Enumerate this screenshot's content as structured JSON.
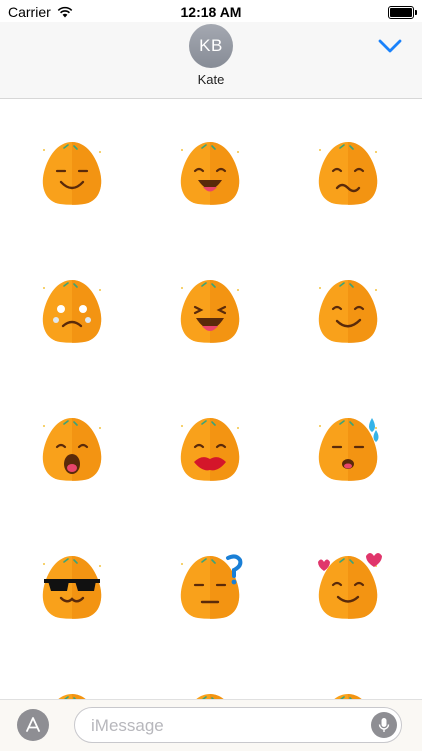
{
  "status_bar": {
    "carrier": "Carrier",
    "time": "12:18 AM",
    "icons": [
      "wifi-icon",
      "battery-icon"
    ]
  },
  "header": {
    "avatar_initials": "KB",
    "contact_name": "Kate",
    "collapse_icon": "chevron-down-icon",
    "accent_color": "#1a82fb"
  },
  "stickers": {
    "colors": {
      "body": "#f9a11b",
      "shade": "#ef8a0b",
      "mouth": "#5a2a0a",
      "tongue": "#e8456b",
      "accent_lips": "#d4162a",
      "sparkle": "#f4c542"
    },
    "items": [
      {
        "name": "smile-sticker"
      },
      {
        "name": "grin-tongue-sticker"
      },
      {
        "name": "confused-sticker"
      },
      {
        "name": "crying-sticker"
      },
      {
        "name": "laughing-sticker"
      },
      {
        "name": "smirk-sticker"
      },
      {
        "name": "shocked-sticker"
      },
      {
        "name": "kiss-lips-sticker"
      },
      {
        "name": "sweat-drop-sticker"
      },
      {
        "name": "sunglasses-sticker"
      },
      {
        "name": "question-sticker"
      },
      {
        "name": "love-hearts-sticker"
      },
      {
        "name": "partial-sticker"
      },
      {
        "name": "partial-sticker"
      },
      {
        "name": "partial-sticker"
      }
    ]
  },
  "message_bar": {
    "placeholder": "iMessage",
    "app_store_icon": "app-store-icon",
    "mic_icon": "microphone-icon"
  }
}
